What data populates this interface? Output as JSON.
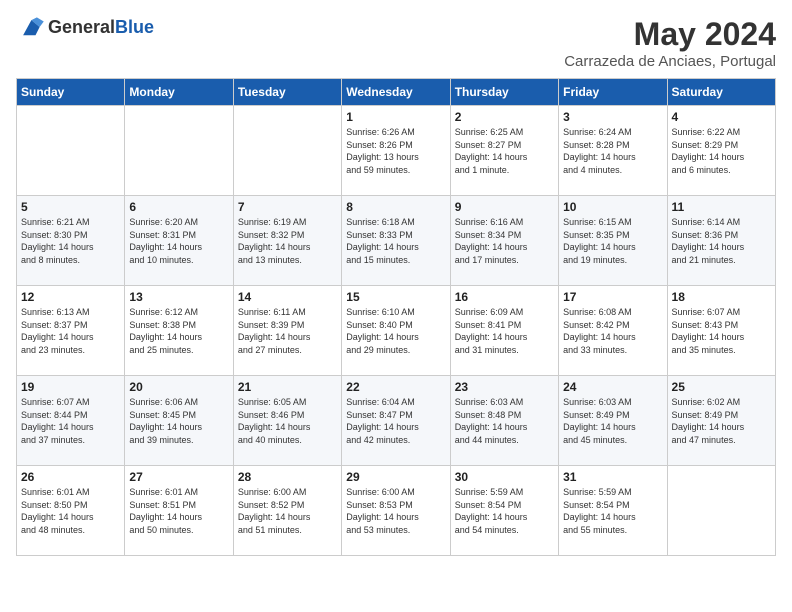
{
  "header": {
    "logo_general": "General",
    "logo_blue": "Blue",
    "month_year": "May 2024",
    "location": "Carrazeda de Anciaes, Portugal"
  },
  "days_of_week": [
    "Sunday",
    "Monday",
    "Tuesday",
    "Wednesday",
    "Thursday",
    "Friday",
    "Saturday"
  ],
  "weeks": [
    [
      {
        "day": "",
        "info": ""
      },
      {
        "day": "",
        "info": ""
      },
      {
        "day": "",
        "info": ""
      },
      {
        "day": "1",
        "info": "Sunrise: 6:26 AM\nSunset: 8:26 PM\nDaylight: 13 hours\nand 59 minutes."
      },
      {
        "day": "2",
        "info": "Sunrise: 6:25 AM\nSunset: 8:27 PM\nDaylight: 14 hours\nand 1 minute."
      },
      {
        "day": "3",
        "info": "Sunrise: 6:24 AM\nSunset: 8:28 PM\nDaylight: 14 hours\nand 4 minutes."
      },
      {
        "day": "4",
        "info": "Sunrise: 6:22 AM\nSunset: 8:29 PM\nDaylight: 14 hours\nand 6 minutes."
      }
    ],
    [
      {
        "day": "5",
        "info": "Sunrise: 6:21 AM\nSunset: 8:30 PM\nDaylight: 14 hours\nand 8 minutes."
      },
      {
        "day": "6",
        "info": "Sunrise: 6:20 AM\nSunset: 8:31 PM\nDaylight: 14 hours\nand 10 minutes."
      },
      {
        "day": "7",
        "info": "Sunrise: 6:19 AM\nSunset: 8:32 PM\nDaylight: 14 hours\nand 13 minutes."
      },
      {
        "day": "8",
        "info": "Sunrise: 6:18 AM\nSunset: 8:33 PM\nDaylight: 14 hours\nand 15 minutes."
      },
      {
        "day": "9",
        "info": "Sunrise: 6:16 AM\nSunset: 8:34 PM\nDaylight: 14 hours\nand 17 minutes."
      },
      {
        "day": "10",
        "info": "Sunrise: 6:15 AM\nSunset: 8:35 PM\nDaylight: 14 hours\nand 19 minutes."
      },
      {
        "day": "11",
        "info": "Sunrise: 6:14 AM\nSunset: 8:36 PM\nDaylight: 14 hours\nand 21 minutes."
      }
    ],
    [
      {
        "day": "12",
        "info": "Sunrise: 6:13 AM\nSunset: 8:37 PM\nDaylight: 14 hours\nand 23 minutes."
      },
      {
        "day": "13",
        "info": "Sunrise: 6:12 AM\nSunset: 8:38 PM\nDaylight: 14 hours\nand 25 minutes."
      },
      {
        "day": "14",
        "info": "Sunrise: 6:11 AM\nSunset: 8:39 PM\nDaylight: 14 hours\nand 27 minutes."
      },
      {
        "day": "15",
        "info": "Sunrise: 6:10 AM\nSunset: 8:40 PM\nDaylight: 14 hours\nand 29 minutes."
      },
      {
        "day": "16",
        "info": "Sunrise: 6:09 AM\nSunset: 8:41 PM\nDaylight: 14 hours\nand 31 minutes."
      },
      {
        "day": "17",
        "info": "Sunrise: 6:08 AM\nSunset: 8:42 PM\nDaylight: 14 hours\nand 33 minutes."
      },
      {
        "day": "18",
        "info": "Sunrise: 6:07 AM\nSunset: 8:43 PM\nDaylight: 14 hours\nand 35 minutes."
      }
    ],
    [
      {
        "day": "19",
        "info": "Sunrise: 6:07 AM\nSunset: 8:44 PM\nDaylight: 14 hours\nand 37 minutes."
      },
      {
        "day": "20",
        "info": "Sunrise: 6:06 AM\nSunset: 8:45 PM\nDaylight: 14 hours\nand 39 minutes."
      },
      {
        "day": "21",
        "info": "Sunrise: 6:05 AM\nSunset: 8:46 PM\nDaylight: 14 hours\nand 40 minutes."
      },
      {
        "day": "22",
        "info": "Sunrise: 6:04 AM\nSunset: 8:47 PM\nDaylight: 14 hours\nand 42 minutes."
      },
      {
        "day": "23",
        "info": "Sunrise: 6:03 AM\nSunset: 8:48 PM\nDaylight: 14 hours\nand 44 minutes."
      },
      {
        "day": "24",
        "info": "Sunrise: 6:03 AM\nSunset: 8:49 PM\nDaylight: 14 hours\nand 45 minutes."
      },
      {
        "day": "25",
        "info": "Sunrise: 6:02 AM\nSunset: 8:49 PM\nDaylight: 14 hours\nand 47 minutes."
      }
    ],
    [
      {
        "day": "26",
        "info": "Sunrise: 6:01 AM\nSunset: 8:50 PM\nDaylight: 14 hours\nand 48 minutes."
      },
      {
        "day": "27",
        "info": "Sunrise: 6:01 AM\nSunset: 8:51 PM\nDaylight: 14 hours\nand 50 minutes."
      },
      {
        "day": "28",
        "info": "Sunrise: 6:00 AM\nSunset: 8:52 PM\nDaylight: 14 hours\nand 51 minutes."
      },
      {
        "day": "29",
        "info": "Sunrise: 6:00 AM\nSunset: 8:53 PM\nDaylight: 14 hours\nand 53 minutes."
      },
      {
        "day": "30",
        "info": "Sunrise: 5:59 AM\nSunset: 8:54 PM\nDaylight: 14 hours\nand 54 minutes."
      },
      {
        "day": "31",
        "info": "Sunrise: 5:59 AM\nSunset: 8:54 PM\nDaylight: 14 hours\nand 55 minutes."
      },
      {
        "day": "",
        "info": ""
      }
    ]
  ]
}
